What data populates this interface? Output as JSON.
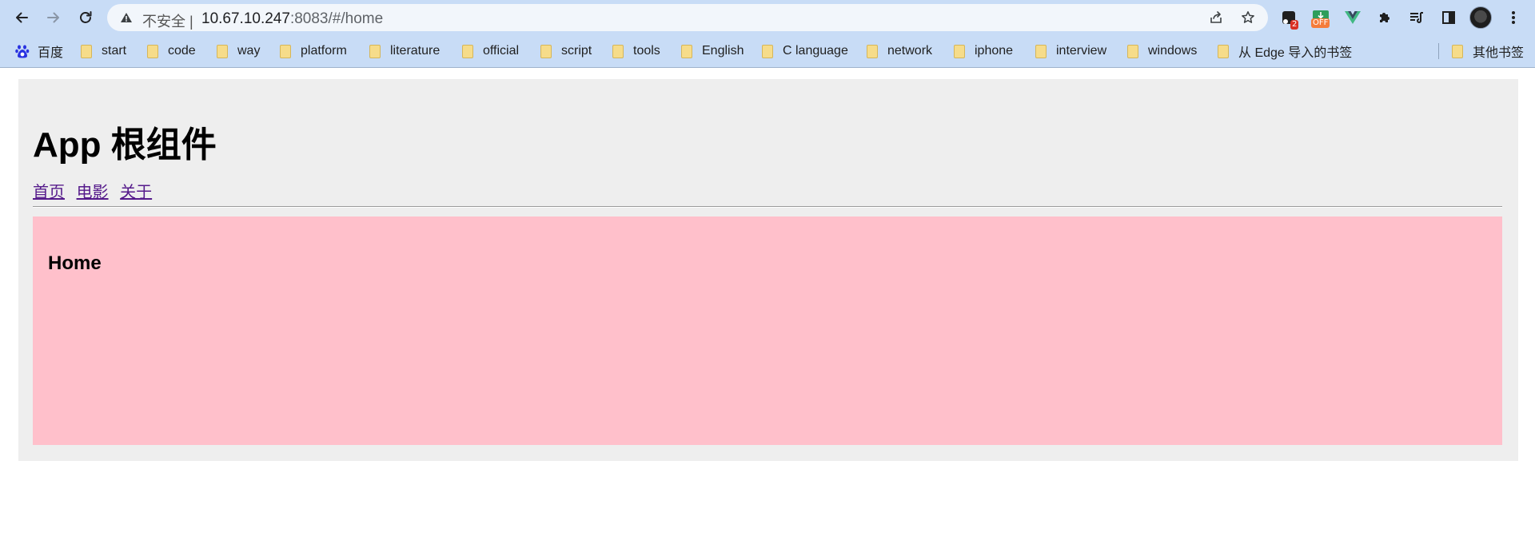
{
  "browser": {
    "security_label": "不安全",
    "address_host": "10.67.10.247",
    "address_rest": ":8083/#/home",
    "extensions": [
      {
        "icon": "extension-square-icon",
        "badge": "2",
        "badge_color": "#d93025"
      },
      {
        "icon": "extension-download-icon",
        "badge": "OFF",
        "badge_color": "#f57c3a"
      },
      {
        "icon": "vue-devtools-icon",
        "badge_color": "#41b883"
      },
      {
        "icon": "puzzle-icon"
      },
      {
        "icon": "reading-list-icon"
      },
      {
        "icon": "side-panel-icon"
      }
    ],
    "accent": "#c8dcf6"
  },
  "bookmarks": {
    "items": [
      {
        "label": "百度",
        "icon": "baidu-paw-icon"
      },
      {
        "label": "start"
      },
      {
        "label": "code"
      },
      {
        "label": "way"
      },
      {
        "label": "platform"
      },
      {
        "label": "literature"
      },
      {
        "label": "official"
      },
      {
        "label": "script"
      },
      {
        "label": "tools"
      },
      {
        "label": "English"
      },
      {
        "label": "C language"
      },
      {
        "label": "network"
      },
      {
        "label": "iphone"
      },
      {
        "label": "interview"
      },
      {
        "label": "windows"
      },
      {
        "label": "从 Edge 导入的书签"
      }
    ],
    "other_label": "其他书签"
  },
  "page": {
    "title": "App 根组件",
    "nav_links": [
      "首页",
      "电影",
      "关于"
    ],
    "view_title": "Home",
    "view_color": "#ffc0cb",
    "link_color": "#551a8b"
  }
}
